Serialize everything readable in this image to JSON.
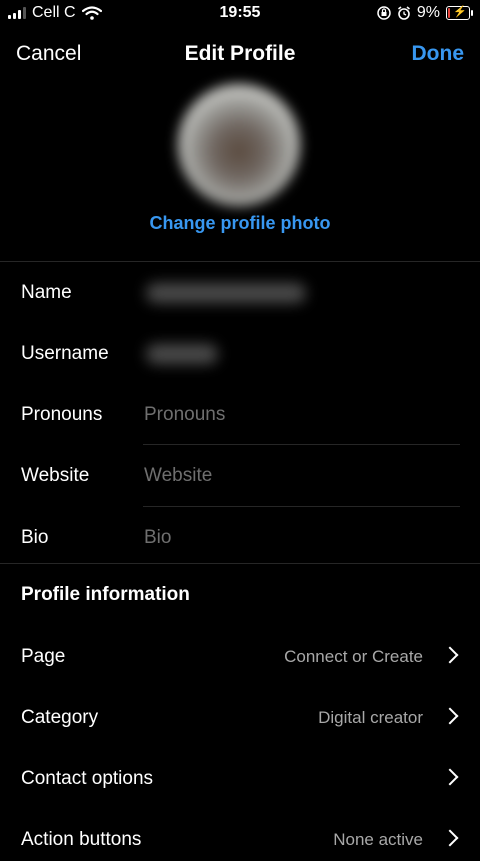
{
  "status_bar": {
    "carrier": "Cell C",
    "time": "19:55",
    "battery_percent": "9%",
    "icons": [
      "signal-icon",
      "wifi-icon",
      "screen-lock-icon",
      "alarm-icon",
      "battery-icon"
    ]
  },
  "header": {
    "cancel_label": "Cancel",
    "title": "Edit Profile",
    "done_label": "Done"
  },
  "profile": {
    "change_photo_label": "Change profile photo"
  },
  "fields": {
    "name": {
      "label": "Name"
    },
    "username": {
      "label": "Username"
    },
    "pronouns": {
      "label": "Pronouns",
      "placeholder": "Pronouns"
    },
    "website": {
      "label": "Website",
      "placeholder": "Website"
    },
    "bio": {
      "label": "Bio",
      "placeholder": "Bio"
    }
  },
  "profile_information": {
    "title": "Profile information",
    "rows": [
      {
        "label": "Page",
        "value": "Connect or Create"
      },
      {
        "label": "Category",
        "value": "Digital creator"
      },
      {
        "label": "Contact options",
        "value": ""
      },
      {
        "label": "Action buttons",
        "value": "None active"
      }
    ]
  },
  "colors": {
    "accent": "#3897f0",
    "background": "#000000",
    "placeholder": "#6f6f6f",
    "secondary_text": "#a8a8a8",
    "battery_low": "#e8453c"
  }
}
